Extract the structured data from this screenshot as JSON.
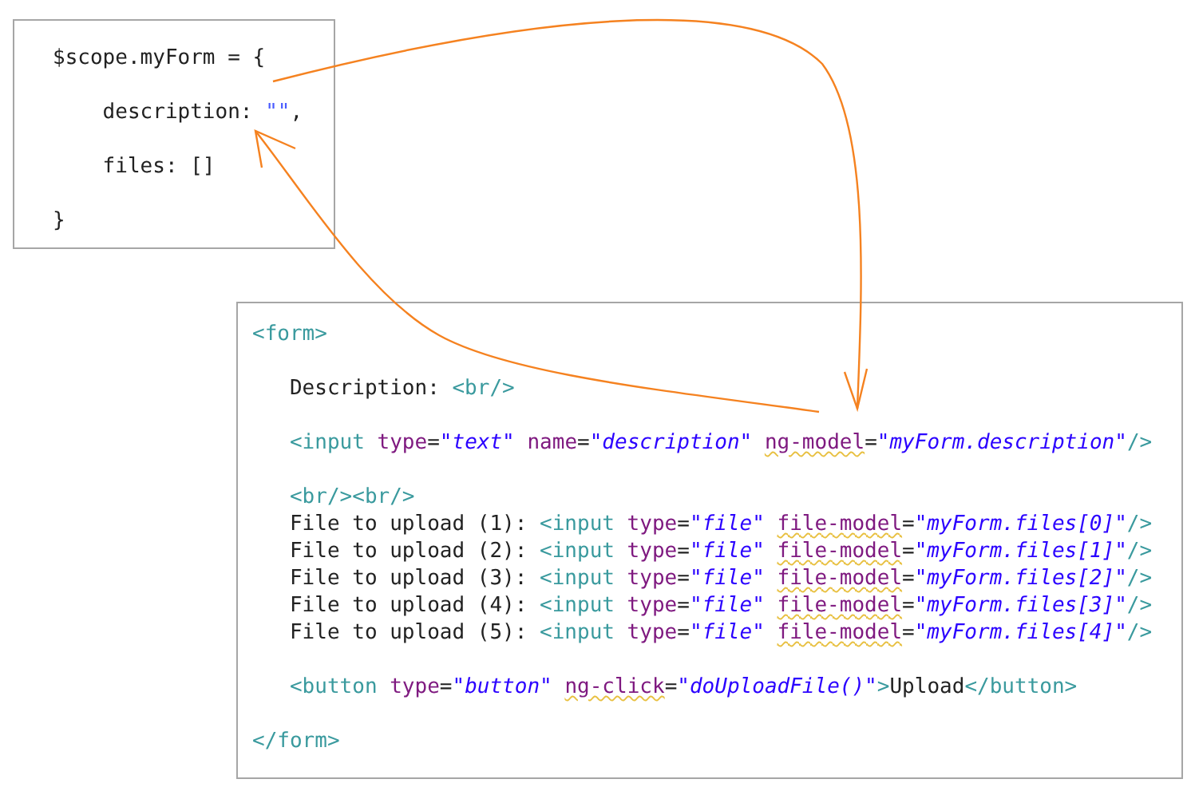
{
  "model_box": {
    "blocks": [
      [
        [
          {
            "kind": "text",
            "text": "$scope.myForm = {"
          }
        ]
      ],
      [
        [
          {
            "kind": "text",
            "text": "    description: "
          },
          {
            "kind": "value",
            "text": "\"\""
          },
          {
            "kind": "text",
            "text": ","
          }
        ]
      ],
      [
        [
          {
            "kind": "text",
            "text": "    files: []"
          }
        ]
      ],
      [
        [
          {
            "kind": "text",
            "text": "}"
          }
        ]
      ]
    ]
  },
  "form_box": {
    "blocks": [
      [
        [
          {
            "kind": "tag",
            "text": "<form>"
          }
        ]
      ],
      [
        [
          {
            "kind": "text",
            "text": "   Description: "
          },
          {
            "kind": "tag",
            "text": "<br/>"
          }
        ]
      ],
      [
        [
          {
            "kind": "tag",
            "text": "   <input"
          },
          {
            "kind": "attr",
            "text": " type"
          },
          {
            "kind": "text",
            "text": "="
          },
          {
            "kind": "string",
            "text": "\"text\""
          },
          {
            "kind": "attr",
            "text": " name"
          },
          {
            "kind": "text",
            "text": "="
          },
          {
            "kind": "string",
            "text": "\"description\" "
          },
          {
            "kind": "attr",
            "text": "ng-model",
            "warning": true
          },
          {
            "kind": "text",
            "text": "="
          },
          {
            "kind": "string",
            "text": "\"myForm.description\""
          },
          {
            "kind": "tag",
            "text": "/>"
          }
        ]
      ],
      [
        [
          {
            "kind": "tag",
            "text": "   <br/><br/>"
          }
        ],
        [
          {
            "kind": "text",
            "text": "   File to upload (1): "
          },
          {
            "kind": "tag",
            "text": "<input"
          },
          {
            "kind": "attr",
            "text": " type"
          },
          {
            "kind": "text",
            "text": "="
          },
          {
            "kind": "string",
            "text": "\"file\" "
          },
          {
            "kind": "attr",
            "text": "file-model",
            "warning": true
          },
          {
            "kind": "text",
            "text": "="
          },
          {
            "kind": "string",
            "text": "\"myForm.files[0]\""
          },
          {
            "kind": "tag",
            "text": "/>"
          }
        ],
        [
          {
            "kind": "text",
            "text": "   File to upload (2): "
          },
          {
            "kind": "tag",
            "text": "<input"
          },
          {
            "kind": "attr",
            "text": " type"
          },
          {
            "kind": "text",
            "text": "="
          },
          {
            "kind": "string",
            "text": "\"file\" "
          },
          {
            "kind": "attr",
            "text": "file-model",
            "warning": true
          },
          {
            "kind": "text",
            "text": "="
          },
          {
            "kind": "string",
            "text": "\"myForm.files[1]\""
          },
          {
            "kind": "tag",
            "text": "/>"
          }
        ],
        [
          {
            "kind": "text",
            "text": "   File to upload (3): "
          },
          {
            "kind": "tag",
            "text": "<input"
          },
          {
            "kind": "attr",
            "text": " type"
          },
          {
            "kind": "text",
            "text": "="
          },
          {
            "kind": "string",
            "text": "\"file\" "
          },
          {
            "kind": "attr",
            "text": "file-model",
            "warning": true
          },
          {
            "kind": "text",
            "text": "="
          },
          {
            "kind": "string",
            "text": "\"myForm.files[2]\""
          },
          {
            "kind": "tag",
            "text": "/>"
          }
        ],
        [
          {
            "kind": "text",
            "text": "   File to upload (4): "
          },
          {
            "kind": "tag",
            "text": "<input"
          },
          {
            "kind": "attr",
            "text": " type"
          },
          {
            "kind": "text",
            "text": "="
          },
          {
            "kind": "string",
            "text": "\"file\" "
          },
          {
            "kind": "attr",
            "text": "file-model",
            "warning": true
          },
          {
            "kind": "text",
            "text": "="
          },
          {
            "kind": "string",
            "text": "\"myForm.files[3]\""
          },
          {
            "kind": "tag",
            "text": "/>"
          }
        ],
        [
          {
            "kind": "text",
            "text": "   File to upload (5): "
          },
          {
            "kind": "tag",
            "text": "<input"
          },
          {
            "kind": "attr",
            "text": " type"
          },
          {
            "kind": "text",
            "text": "="
          },
          {
            "kind": "string",
            "text": "\"file\" "
          },
          {
            "kind": "attr",
            "text": "file-model",
            "warning": true
          },
          {
            "kind": "text",
            "text": "="
          },
          {
            "kind": "string",
            "text": "\"myForm.files[4]\""
          },
          {
            "kind": "tag",
            "text": "/>"
          }
        ]
      ],
      [
        [
          {
            "kind": "tag",
            "text": "   <button"
          },
          {
            "kind": "attr",
            "text": " type"
          },
          {
            "kind": "text",
            "text": "="
          },
          {
            "kind": "string",
            "text": "\"button\" "
          },
          {
            "kind": "attr",
            "text": "ng-click",
            "warning": true
          },
          {
            "kind": "text",
            "text": "="
          },
          {
            "kind": "string",
            "text": "\"doUploadFile()\""
          },
          {
            "kind": "tag",
            "text": ">"
          },
          {
            "kind": "text",
            "text": "Upload"
          },
          {
            "kind": "tag",
            "text": "</button>"
          }
        ]
      ],
      [
        [
          {
            "kind": "tag",
            "text": "</form>"
          }
        ]
      ]
    ]
  }
}
